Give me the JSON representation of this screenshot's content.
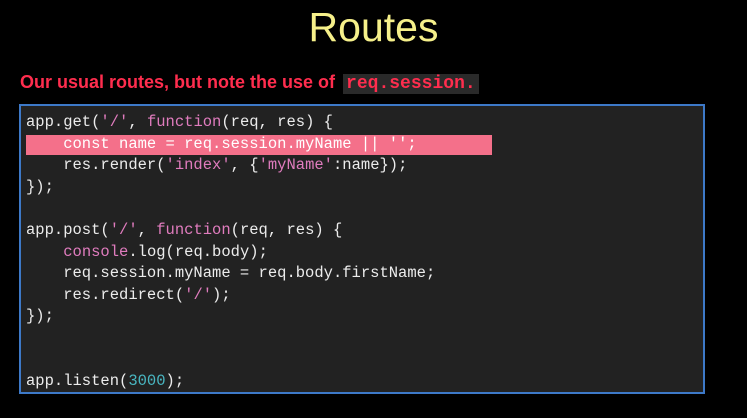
{
  "slide": {
    "title": "Routes",
    "subtitle_text": "Our usual routes, but note the use of",
    "subtitle_code": "req.session."
  },
  "code": {
    "l1": [
      "app.get(",
      "'/'",
      ", ",
      "function",
      "(req, res) {"
    ],
    "l2": [
      "    const name = req.session.myName || ",
      "''",
      ";"
    ],
    "l3": [
      "    res.render(",
      "'index'",
      ", {",
      "'myName'",
      ":name});"
    ],
    "l4": [
      "});"
    ],
    "l6": [
      "app.post(",
      "'/'",
      ", ",
      "function",
      "(req, res) {"
    ],
    "l7": [
      "    ",
      "console",
      ".log(req.body);"
    ],
    "l8": [
      "    req.session.myName = req.body.firstName;"
    ],
    "l9": [
      "    res.redirect(",
      "'/'",
      ");"
    ],
    "l10": [
      "});"
    ],
    "l13": [
      "app.listen(",
      "3000",
      ");"
    ]
  },
  "colors": {
    "title": "#f6f08a",
    "subtitle": "#ff2d4e",
    "code_box_border": "#3d79c8",
    "code_bg": "#222222",
    "highlight": "#f4708a",
    "keyword": "#e07cbe",
    "number": "#49b7c2"
  }
}
